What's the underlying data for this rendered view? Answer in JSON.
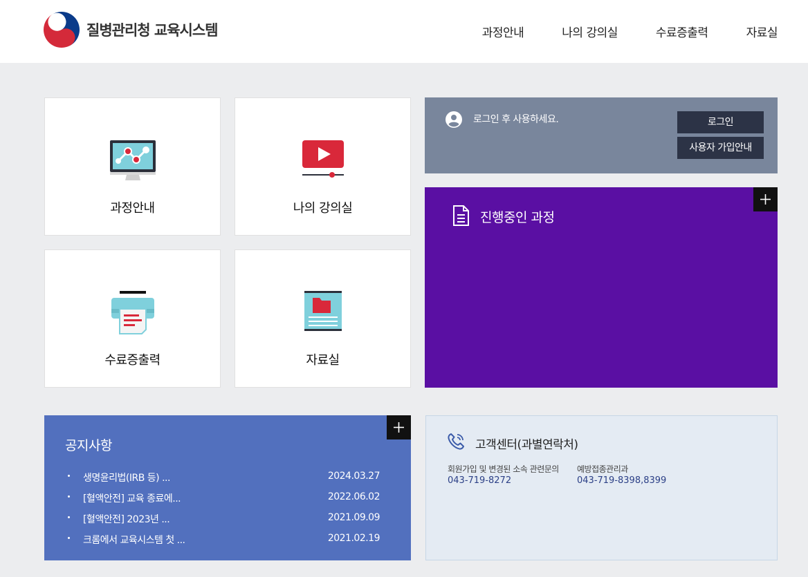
{
  "header": {
    "logo_text": "질병관리청 교육시스템",
    "nav": [
      "과정안내",
      "나의 강의실",
      "수료증출력",
      "자료실"
    ]
  },
  "tiles": [
    {
      "label": "과정안내",
      "icon": "monitor-chart-icon"
    },
    {
      "label": "나의 강의실",
      "icon": "video-play-icon"
    },
    {
      "label": "수료증출력",
      "icon": "printer-icon"
    },
    {
      "label": "자료실",
      "icon": "folder-book-icon"
    }
  ],
  "login": {
    "message": "로그인 후 사용하세요.",
    "login_button": "로그인",
    "signup_button": "사용자 가입안내"
  },
  "progress": {
    "title": "진행중인 과정",
    "plus": "+"
  },
  "notice": {
    "title": "공지사항",
    "plus": "+",
    "items": [
      {
        "title": "생명윤리법(IRB 등) ...",
        "date": "2024.03.27"
      },
      {
        "title": "[혈액안전] 교육 종료에...",
        "date": "2022.06.02"
      },
      {
        "title": "[혈액안전] 2023년 ...",
        "date": "2021.09.09"
      },
      {
        "title": "크롬에서 교육시스템 첫 ...",
        "date": "2021.02.19"
      }
    ]
  },
  "customer_center": {
    "title": "고객센터(과별연락처)",
    "contacts": [
      {
        "label": "회원가입 및 변경된 소속 관련문의",
        "number": "043-719-8272"
      },
      {
        "label": "예방접종관리과",
        "number": "043-719-8398,8399"
      }
    ]
  },
  "colors": {
    "login_panel": "#79869c",
    "progress_panel": "#5a0fa3",
    "notice_panel": "#5270be",
    "cs_panel": "#e4ebf3",
    "page_bg": "#ecedef"
  }
}
